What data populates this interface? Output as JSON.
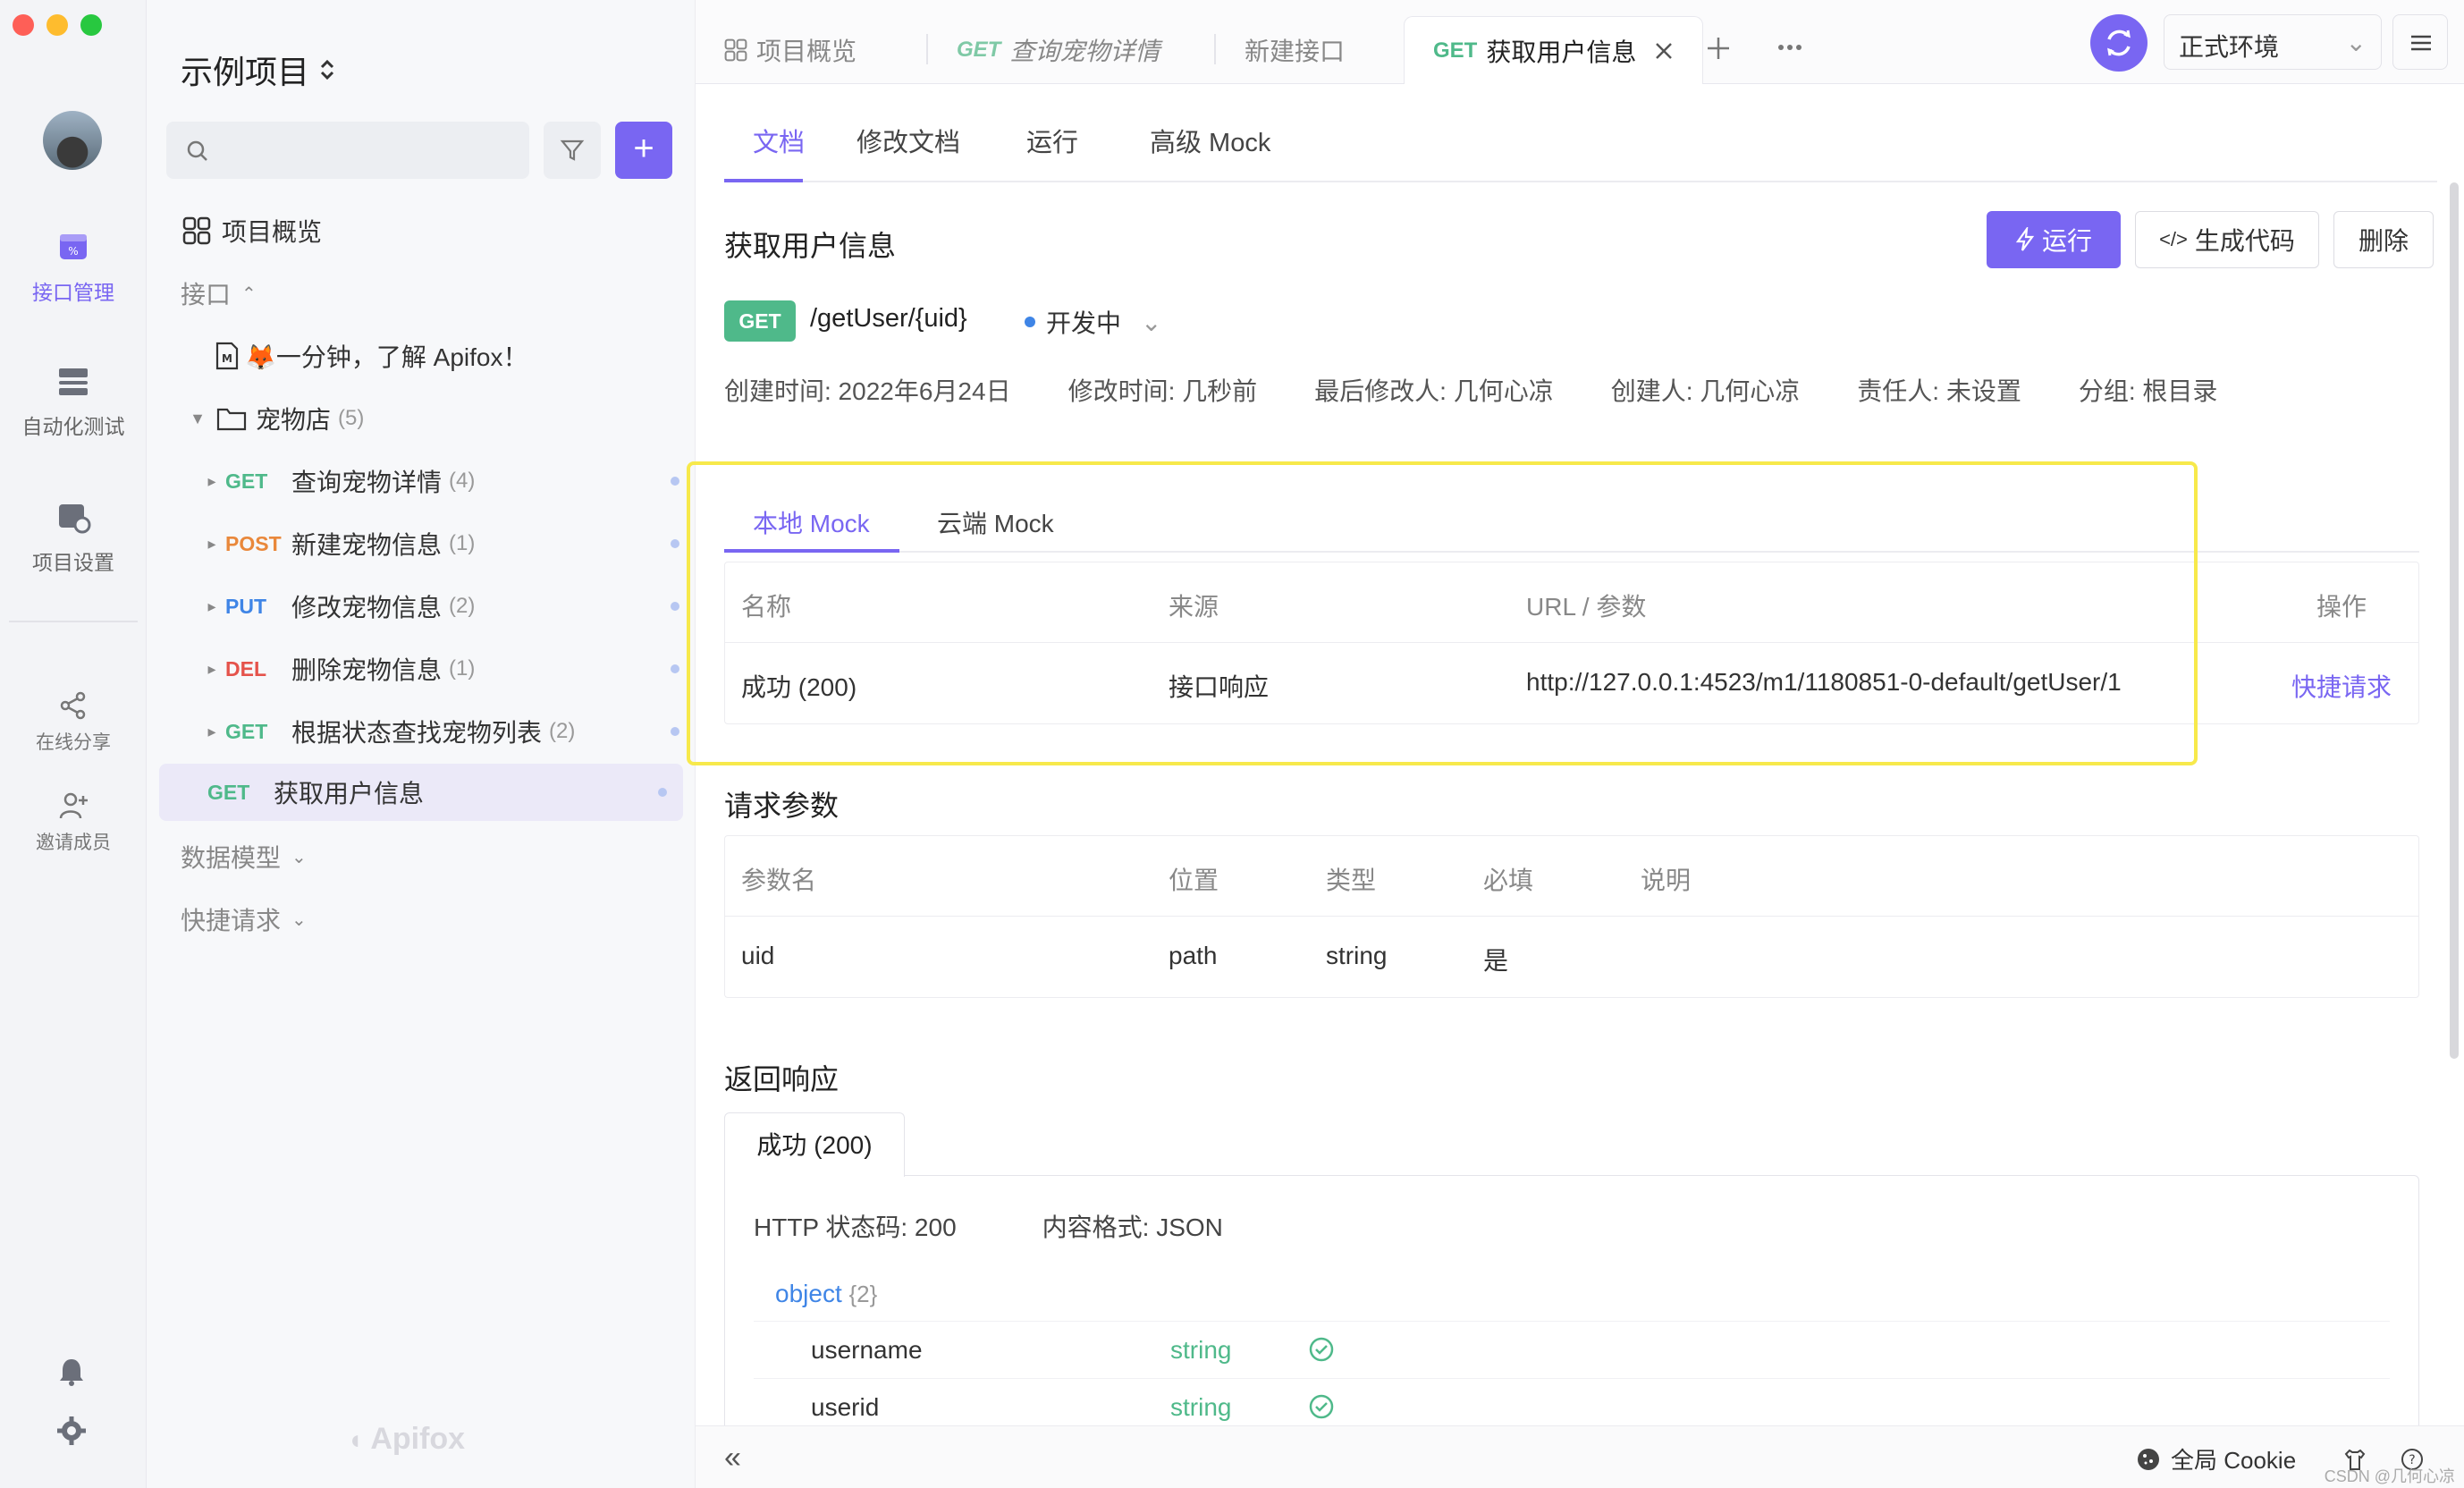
{
  "window": {
    "traffic_colors": [
      "#fe5f57",
      "#febc2e",
      "#28c840"
    ]
  },
  "colors": {
    "accent": "#7966f2",
    "get": "#4fb98a",
    "post": "#e9883b",
    "put": "#3f85e6",
    "delete": "#e5534b",
    "highlight": "#f7e94b"
  },
  "rail": {
    "items": [
      {
        "label": "接口管理",
        "icon": "api-management-icon"
      },
      {
        "label": "自动化测试",
        "icon": "automation-test-icon"
      },
      {
        "label": "项目设置",
        "icon": "project-settings-icon"
      },
      {
        "label": "在线分享",
        "icon": "share-icon"
      },
      {
        "label": "邀请成员",
        "icon": "invite-member-icon"
      }
    ]
  },
  "sidebar": {
    "project_title": "示例项目",
    "overview": "项目概览",
    "api_section": "接口",
    "intro_doc": "🦊一分钟，了解 Apifox！",
    "folder": {
      "name": "宠物店",
      "count": "(5)"
    },
    "endpoints": [
      {
        "method": "GET",
        "name": "查询宠物详情",
        "count": "(4)"
      },
      {
        "method": "POST",
        "name": "新建宠物信息",
        "count": "(1)"
      },
      {
        "method": "PUT",
        "name": "修改宠物信息",
        "count": "(2)"
      },
      {
        "method": "DEL",
        "name": "删除宠物信息",
        "count": "(1)"
      },
      {
        "method": "GET",
        "name": "根据状态查找宠物列表",
        "count": "(2)"
      }
    ],
    "selected": {
      "method": "GET",
      "name": "获取用户信息"
    },
    "data_models": "数据模型",
    "quick_requests": "快捷请求",
    "brand": "Apifox"
  },
  "tabs": [
    {
      "method": "",
      "label": "项目概览"
    },
    {
      "method": "GET",
      "label": "查询宠物详情"
    },
    {
      "method": "",
      "label": "新建接口"
    },
    {
      "method": "GET",
      "label": "获取用户信息"
    }
  ],
  "environment": "正式环境",
  "subtabs": [
    "文档",
    "修改文档",
    "运行",
    "高级 Mock"
  ],
  "api": {
    "title": "获取用户信息",
    "method": "GET",
    "path": "/getUser/{uid}",
    "status": "开发中",
    "run_label": "运行",
    "gen_code_label": "生成代码",
    "delete_label": "删除",
    "meta": [
      "创建时间: 2022年6月24日",
      "修改时间: 几秒前",
      "最后修改人: 几何心凉",
      "创建人: 几何心凉",
      "责任人: 未设置",
      "分组: 根目录"
    ]
  },
  "mock": {
    "tabs": [
      "本地 Mock",
      "云端 Mock"
    ],
    "headers": [
      "名称",
      "来源",
      "URL / 参数",
      "操作"
    ],
    "row": {
      "name": "成功 (200)",
      "source": "接口响应",
      "url": "http://127.0.0.1:4523/m1/1180851-0-default/getUser/1",
      "action": "快捷请求"
    }
  },
  "request_params": {
    "title": "请求参数",
    "headers": [
      "参数名",
      "位置",
      "类型",
      "必填",
      "说明"
    ],
    "rows": [
      {
        "name": "uid",
        "location": "path",
        "type": "string",
        "required": "是",
        "desc": ""
      }
    ]
  },
  "response": {
    "title": "返回响应",
    "tab": "成功 (200)",
    "status_code": "HTTP 状态码: 200",
    "content_type": "内容格式: JSON",
    "root_type": "object",
    "root_count": "{2}",
    "fields": [
      {
        "name": "username",
        "type": "string"
      },
      {
        "name": "userid",
        "type": "string"
      }
    ]
  },
  "footer": {
    "cookie": "全局 Cookie",
    "watermark": "CSDN @几何心凉"
  }
}
